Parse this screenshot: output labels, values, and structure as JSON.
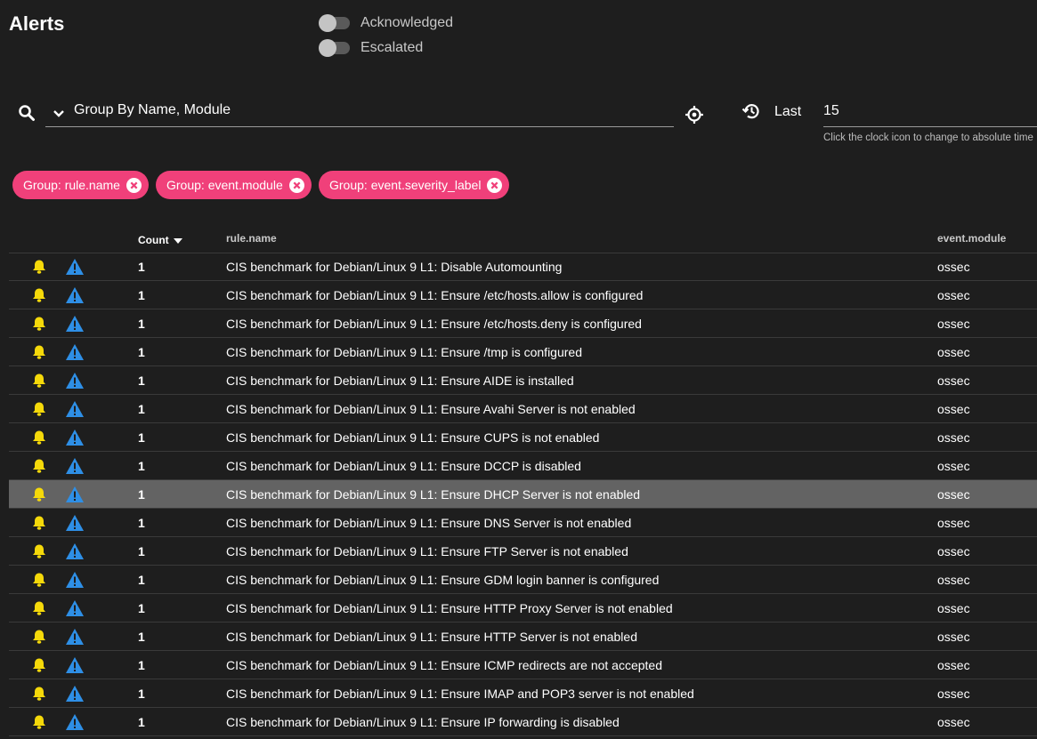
{
  "header": {
    "title": "Alerts"
  },
  "toggles": [
    {
      "label": "Acknowledged",
      "on": false
    },
    {
      "label": "Escalated",
      "on": false
    }
  ],
  "search": {
    "group_by_value": "Group By Name, Module",
    "last_label": "Last",
    "time_value": "15",
    "time_hint": "Click the clock icon to change to absolute time"
  },
  "chips": [
    {
      "label": "Group: rule.name"
    },
    {
      "label": "Group: event.module"
    },
    {
      "label": "Group: event.severity_label"
    }
  ],
  "colors": {
    "accent_chip": "#f0407a",
    "bell": "#f5d90a",
    "warning": "#2e8fe6",
    "selected_row": "#636363"
  },
  "table": {
    "columns": {
      "count": "Count",
      "rule": "rule.name",
      "module": "event.module"
    },
    "sort": {
      "column": "Count",
      "direction": "descending"
    },
    "selected_row_index": 8,
    "rows": [
      {
        "count": "1",
        "rule": "CIS benchmark for Debian/Linux 9 L1: Disable Automounting",
        "module": "ossec"
      },
      {
        "count": "1",
        "rule": "CIS benchmark for Debian/Linux 9 L1: Ensure /etc/hosts.allow is configured",
        "module": "ossec"
      },
      {
        "count": "1",
        "rule": "CIS benchmark for Debian/Linux 9 L1: Ensure /etc/hosts.deny is configured",
        "module": "ossec"
      },
      {
        "count": "1",
        "rule": "CIS benchmark for Debian/Linux 9 L1: Ensure /tmp is configured",
        "module": "ossec"
      },
      {
        "count": "1",
        "rule": "CIS benchmark for Debian/Linux 9 L1: Ensure AIDE is installed",
        "module": "ossec"
      },
      {
        "count": "1",
        "rule": "CIS benchmark for Debian/Linux 9 L1: Ensure Avahi Server is not enabled",
        "module": "ossec"
      },
      {
        "count": "1",
        "rule": "CIS benchmark for Debian/Linux 9 L1: Ensure CUPS is not enabled",
        "module": "ossec"
      },
      {
        "count": "1",
        "rule": "CIS benchmark for Debian/Linux 9 L1: Ensure DCCP is disabled",
        "module": "ossec"
      },
      {
        "count": "1",
        "rule": "CIS benchmark for Debian/Linux 9 L1: Ensure DHCP Server is not enabled",
        "module": "ossec"
      },
      {
        "count": "1",
        "rule": "CIS benchmark for Debian/Linux 9 L1: Ensure DNS Server is not enabled",
        "module": "ossec"
      },
      {
        "count": "1",
        "rule": "CIS benchmark for Debian/Linux 9 L1: Ensure FTP Server is not enabled",
        "module": "ossec"
      },
      {
        "count": "1",
        "rule": "CIS benchmark for Debian/Linux 9 L1: Ensure GDM login banner is configured",
        "module": "ossec"
      },
      {
        "count": "1",
        "rule": "CIS benchmark for Debian/Linux 9 L1: Ensure HTTP Proxy Server is not enabled",
        "module": "ossec"
      },
      {
        "count": "1",
        "rule": "CIS benchmark for Debian/Linux 9 L1: Ensure HTTP Server is not enabled",
        "module": "ossec"
      },
      {
        "count": "1",
        "rule": "CIS benchmark for Debian/Linux 9 L1: Ensure ICMP redirects are not accepted",
        "module": "ossec"
      },
      {
        "count": "1",
        "rule": "CIS benchmark for Debian/Linux 9 L1: Ensure IMAP and POP3 server is not enabled",
        "module": "ossec"
      },
      {
        "count": "1",
        "rule": "CIS benchmark for Debian/Linux 9 L1: Ensure IP forwarding is disabled",
        "module": "ossec"
      }
    ]
  }
}
